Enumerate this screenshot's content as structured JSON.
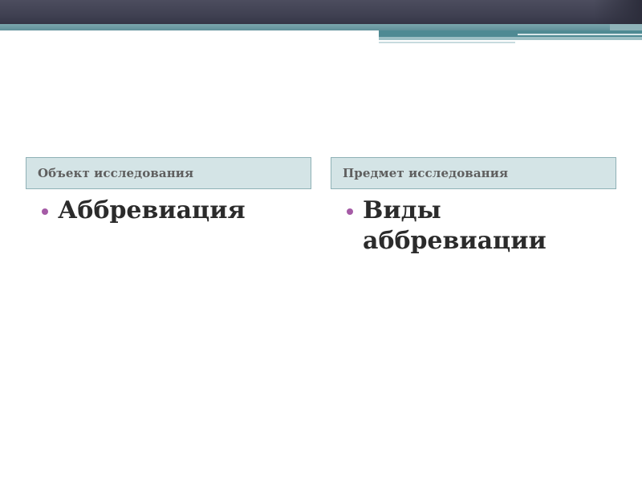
{
  "slide": {
    "columns": [
      {
        "header": "Объект исследования",
        "items": [
          "Аббревиация"
        ]
      },
      {
        "header": "Предмет исследования",
        "items": [
          "Виды аббревиации"
        ]
      }
    ]
  },
  "colors": {
    "banner": "#3e3f50",
    "teal_accent": "#5f8f98",
    "header_fill": "#d4e4e6",
    "header_border": "#8fb1b6",
    "header_text": "#5f5f5f",
    "body_text": "#2b2b2b",
    "bullet": "#a55ba6"
  },
  "icons": {
    "bullet": "bullet-dot-icon"
  }
}
